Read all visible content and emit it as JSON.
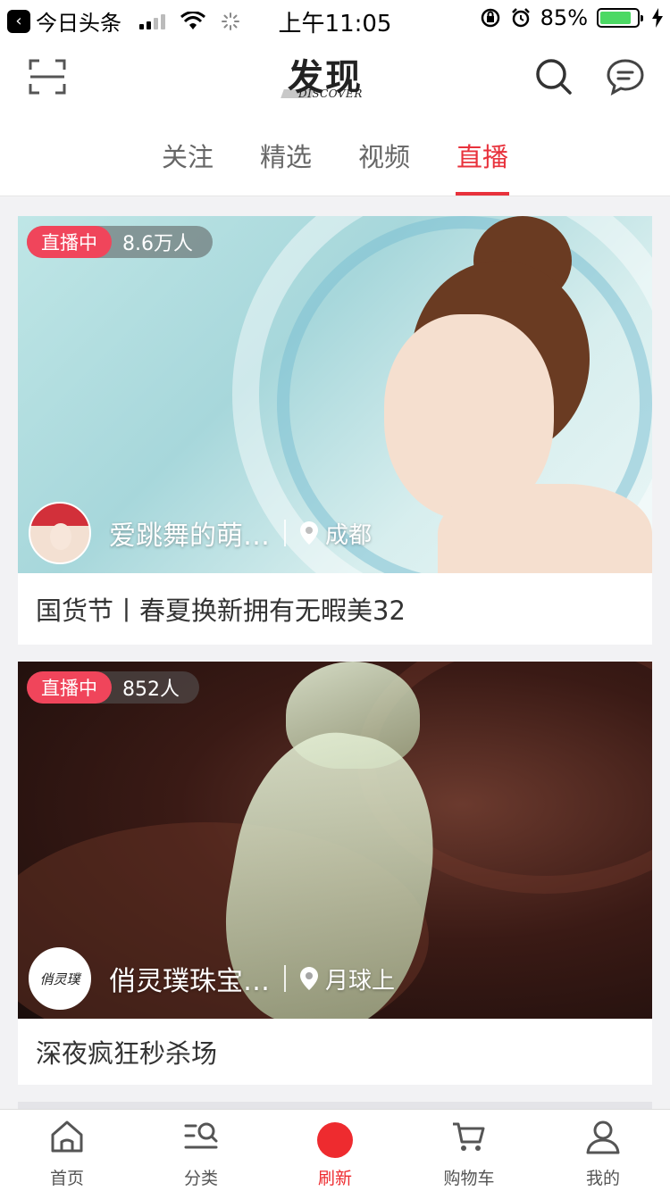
{
  "status_bar": {
    "app_back_label": "今日头条",
    "time": "上午11:05",
    "battery": "85%",
    "battery_level": 0.85
  },
  "header": {
    "logo_title": "发现",
    "logo_subtitle": "DISCOVER"
  },
  "tabs": [
    {
      "label": "关注",
      "active": false
    },
    {
      "label": "精选",
      "active": false
    },
    {
      "label": "视频",
      "active": false
    },
    {
      "label": "直播",
      "active": true
    }
  ],
  "cards": [
    {
      "live_tag": "直播中",
      "viewers": "8.6万人",
      "owner_name": "爱跳舞的萌…",
      "location": "成都",
      "title": "国货节丨春夏换新拥有无暇美32"
    },
    {
      "live_tag": "直播中",
      "viewers": "852人",
      "owner_name": "俏灵璞珠宝…",
      "owner_avatar_text": "俏灵璞",
      "location": "月球上",
      "title": "深夜疯狂秒杀场"
    }
  ],
  "bottom_nav": [
    {
      "label": "首页",
      "icon": "home-icon"
    },
    {
      "label": "分类",
      "icon": "category-search-icon"
    },
    {
      "label": "刷新",
      "icon": "refresh-dot-icon",
      "active": true
    },
    {
      "label": "购物车",
      "icon": "cart-icon"
    },
    {
      "label": "我的",
      "icon": "user-icon"
    }
  ],
  "colors": {
    "accent": "#e8323c",
    "live_tag": "#f0455b"
  }
}
